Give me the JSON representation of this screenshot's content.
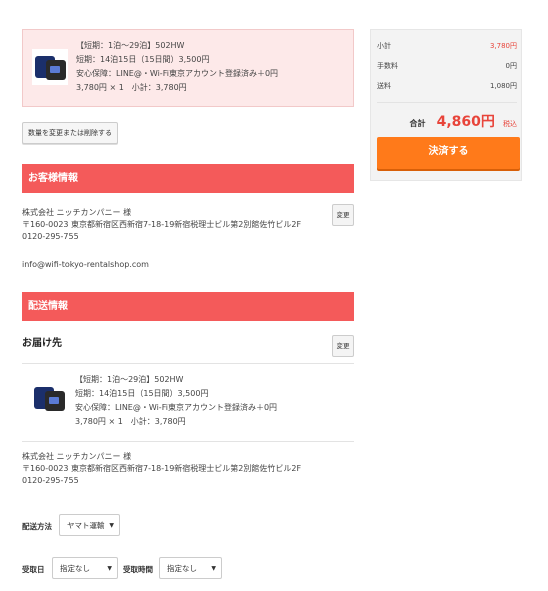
{
  "cart_item": {
    "lines": [
      "【短期：1泊〜29泊】502HW",
      "短期：14泊15日（15日間）3,500円",
      "安心保障：LINE@・Wi-Fi東京アカウント登録済み＋0円",
      "3,780円 × 1　小計：3,780円"
    ],
    "image_icon": "pocket-wifi-router-icon"
  },
  "change_qty_label": "数量を変更または削除する",
  "customer": {
    "heading": "お客様情報",
    "lines": [
      "株式会社 ニッチカンパニー 様",
      "〒160-0023 東京都新宿区西新宿7-18-19新宿税理士ビル第2別館佐竹ビル2F",
      "0120-295-755"
    ],
    "email": "info@wifi-tokyo-rentalshop.com",
    "edit_label": "変更"
  },
  "shipping": {
    "heading": "配送情報",
    "destination_title": "お届け先",
    "edit_label": "変更",
    "item_lines": [
      "【短期：1泊〜29泊】502HW",
      "短期：14泊15日（15日間）3,500円",
      "安心保障：LINE@・Wi-Fi東京アカウント登録済み＋0円",
      "3,780円 × 1　小計：3,780円"
    ],
    "address_lines": [
      "株式会社 ニッチカンパニー 様",
      "〒160-0023 東京都新宿区西新宿7-18-19新宿税理士ビル第2別館佐竹ビル2F",
      "0120-295-755"
    ],
    "method_label": "配送方法",
    "method_value": "ヤマト運輸",
    "date_label": "受取日",
    "date_value": "指定なし",
    "time_label": "受取時間",
    "time_value": "指定なし"
  },
  "summary": {
    "subtotal_label": "小計",
    "subtotal_value": "3,780円",
    "fee_label": "手数料",
    "fee_value": "0円",
    "shipping_label": "送料",
    "shipping_value": "1,080円",
    "total_label": "合計",
    "total_value": "4,860円",
    "tax_label": "税込",
    "checkout_label": "決済する"
  },
  "colors": {
    "accent_red": "#f45a5a",
    "checkout_orange": "#ff7a1a",
    "price_red": "#e8443a"
  }
}
